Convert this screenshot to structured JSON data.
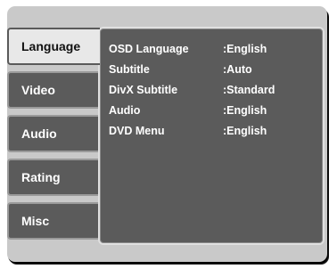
{
  "tabs": [
    {
      "label": "Language",
      "active": true
    },
    {
      "label": "Video",
      "active": false
    },
    {
      "label": "Audio",
      "active": false
    },
    {
      "label": "Rating",
      "active": false
    },
    {
      "label": "Misc",
      "active": false
    }
  ],
  "settings": [
    {
      "label": "OSD Language",
      "value": ":English"
    },
    {
      "label": "Subtitle",
      "value": ":Auto"
    },
    {
      "label": "DivX Subtitle",
      "value": ":Standard"
    },
    {
      "label": "Audio",
      "value": ":English"
    },
    {
      "label": "DVD Menu",
      "value": ":English"
    }
  ],
  "colors": {
    "frame": "#c9c9c9",
    "panel": "#5b5b5b",
    "active_tab": "#e8e8e8",
    "text": "#ffffff"
  }
}
